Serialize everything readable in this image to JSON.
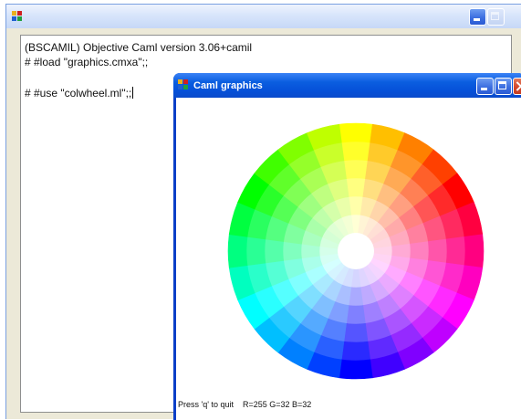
{
  "main_window": {
    "title": "",
    "console_lines": [
      "(BSCAMIL) Objective Caml version 3.06+camil",
      "# #load \"graphics.cmxa\";;",
      "",
      "# #use \"colwheel.ml\";;"
    ]
  },
  "graphics_window": {
    "title": "Caml graphics",
    "status": "Press 'q' to quit    R=255 G=32 B=32"
  },
  "color_wheel": {
    "rings": 6,
    "sectors": 24,
    "center_color": "#ffffff",
    "hue_at_top": "yellow",
    "direction": "clockwise"
  },
  "colors": {
    "titlebar_blue": "#0550d8",
    "close_red": "#d2462a"
  }
}
